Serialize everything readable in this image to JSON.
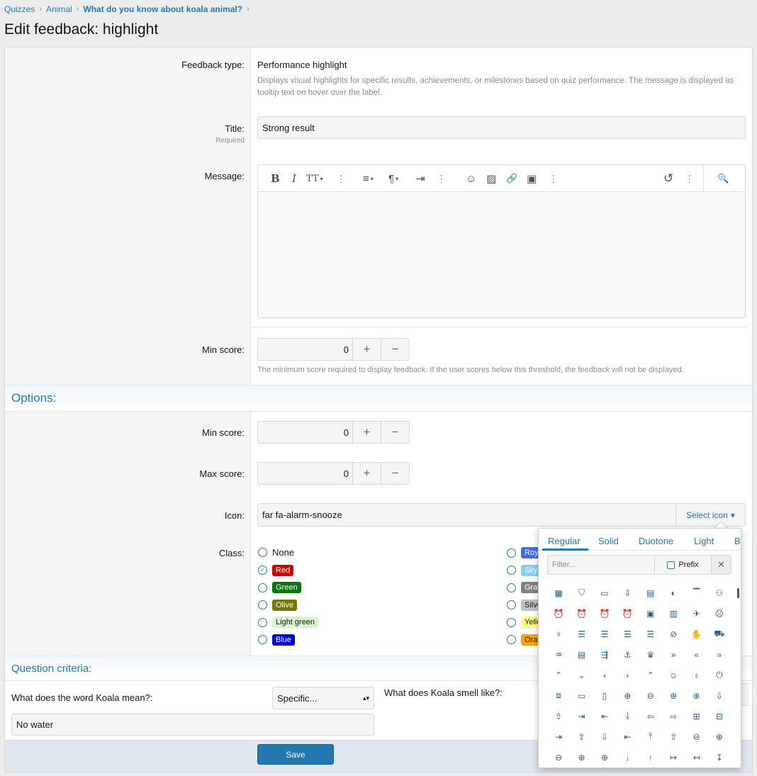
{
  "breadcrumb": [
    {
      "label": "Quizzes"
    },
    {
      "label": "Animal"
    },
    {
      "label": "What do you know about koala animal?"
    }
  ],
  "page_title": "Edit feedback: highlight",
  "feedback_type": {
    "label": "Feedback type:",
    "value": "Performance highlight",
    "description": "Displays visual highlights for specific results, achievements, or milestones based on quiz performance. The message is displayed as tooltip text on hover over the label."
  },
  "title_field": {
    "label": "Title:",
    "hint": "Required",
    "value": "Strong result"
  },
  "message": {
    "label": "Message:",
    "toolbar": {
      "bold": "B",
      "italic": "I",
      "text_size": "TT",
      "more": "⋮",
      "align": "≡",
      "paragraph": "¶",
      "indent": "⇥",
      "emoji": "☺",
      "image": "▨",
      "link": "🔗",
      "media": "▣",
      "undo": "↺",
      "preview": "🔍"
    }
  },
  "min_score_main": {
    "label": "Min score:",
    "value": "0",
    "plus": "+",
    "minus": "−",
    "help": "The minimum score required to display feedback. If the user scores below this threshold, the feedback will not be displayed."
  },
  "options": {
    "header": "Options:",
    "min_score": {
      "label": "Min score:",
      "value": "0"
    },
    "max_score": {
      "label": "Max score:",
      "value": "0"
    },
    "plus": "+",
    "minus": "−",
    "icon": {
      "label": "Icon:",
      "value": "far fa-alarm-snooze",
      "select_label": "Select icon",
      "caret": "▾"
    },
    "class": {
      "label": "Class:",
      "left": [
        {
          "name": "None",
          "bg": "",
          "fg": "#141414"
        },
        {
          "name": "Red",
          "bg": "#cc0000",
          "fg": "#ffffff",
          "checked": true
        },
        {
          "name": "Green",
          "bg": "#007700",
          "fg": "#ffffff"
        },
        {
          "name": "Olive",
          "bg": "#777700",
          "fg": "#ffffff"
        },
        {
          "name": "Light green",
          "bg": "#d8f5d0",
          "fg": "#141414"
        },
        {
          "name": "Blue",
          "bg": "#0000cc",
          "fg": "#ffffff"
        }
      ],
      "right": [
        {
          "name": "Roy",
          "bg": "#4169e1",
          "fg": "#ffffff"
        },
        {
          "name": "Sky",
          "bg": "#87ceeb",
          "fg": "#ffffff"
        },
        {
          "name": "Gray",
          "bg": "#808080",
          "fg": "#ffffff"
        },
        {
          "name": "Silve",
          "bg": "#c0c0c0",
          "fg": "#141414"
        },
        {
          "name": "Yello",
          "bg": "#ffff88",
          "fg": "#141414"
        },
        {
          "name": "Oran",
          "bg": "#ffa500",
          "fg": "#141414"
        }
      ]
    }
  },
  "question_criteria": {
    "header": "Question criteria:",
    "q1": {
      "label": "What does the word Koala mean?:",
      "select": "Specific...",
      "answer": "No water"
    },
    "q2": {
      "label": "What does Koala smell like?:"
    }
  },
  "save_label": "Save",
  "icon_picker": {
    "tabs": [
      "Regular",
      "Solid",
      "Duotone",
      "Light",
      "Br"
    ],
    "filter_placeholder": "Filter...",
    "prefix_label": "Prefix",
    "clear": "✕",
    "icons": [
      "▦",
      "⛉",
      "▭",
      "⇩",
      "▤",
      "◐",
      "▔",
      "⚇",
      "⏰",
      "⏰",
      "⏰",
      "⏰",
      "▣",
      "▥",
      "✈",
      "☹",
      "♆",
      "☰",
      "☰",
      "☰",
      "☰",
      "⊘",
      "✋",
      "⛟",
      "♒",
      "▤",
      "⇶",
      "⚓",
      "♛",
      "»",
      "«",
      "»",
      "⌃",
      "⌄",
      "‹",
      "›",
      "⌃",
      "☺",
      "♁",
      "⏻",
      "⧈",
      "▭",
      "▯",
      "⊕",
      "⊖",
      "⊕",
      "⊕",
      "⇩",
      "⇪",
      "⇥",
      "⇤",
      "⤓",
      "⇦",
      "⇨",
      "⊞",
      "⊟",
      "⇥",
      "⇧",
      "⇩",
      "⇤",
      "⤒",
      "⇧",
      "⊖",
      "⊕",
      "⊖",
      "⊕",
      "⊕",
      "↓",
      "↑",
      "↦",
      "↤",
      "↧"
    ]
  }
}
